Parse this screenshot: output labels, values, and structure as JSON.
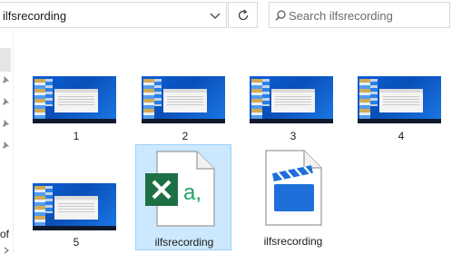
{
  "address_bar": {
    "path": "ilfsrecording"
  },
  "search": {
    "placeholder": "Search ilfsrecording"
  },
  "nav": {
    "fragment": "of"
  },
  "files": [
    {
      "name": "1",
      "type": "image"
    },
    {
      "name": "2",
      "type": "image"
    },
    {
      "name": "3",
      "type": "image"
    },
    {
      "name": "4",
      "type": "image"
    },
    {
      "name": "5",
      "type": "image"
    },
    {
      "name": "ilfsrecording",
      "type": "csv",
      "icon": "excel-csv-icon",
      "selected": true
    },
    {
      "name": "ilfsrecording",
      "type": "video",
      "icon": "video-clapperboard-icon"
    }
  ],
  "colors": {
    "selection_fill": "#cce8ff",
    "selection_border": "#99d1ff",
    "excel_green": "#1d7044",
    "video_blue": "#1e6fd9"
  }
}
